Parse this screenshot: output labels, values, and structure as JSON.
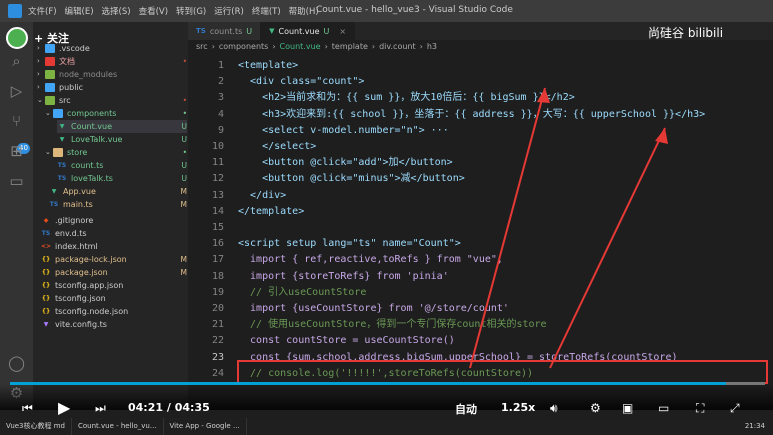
{
  "titlebar": {
    "menus": [
      "文件(F)",
      "编辑(E)",
      "选择(S)",
      "查看(V)",
      "转到(G)",
      "运行(R)",
      "终端(T)",
      "帮助(H)"
    ],
    "window_title": "Count.vue - hello_vue3 - Visual Studio Code"
  },
  "overlay": {
    "follow_label": "+ 关注",
    "brand": "尚硅谷 bilibili"
  },
  "sidebar": {
    "items": [
      {
        "name": ".vscode",
        "status": ""
      },
      {
        "name": "文档",
        "status": ""
      },
      {
        "name": "node_modules",
        "status": ""
      },
      {
        "name": "public",
        "status": ""
      },
      {
        "name": "src",
        "status": ""
      },
      {
        "name": "components",
        "status": ""
      },
      {
        "name": "Count.vue",
        "status": "U"
      },
      {
        "name": "LoveTalk.vue",
        "status": "U"
      },
      {
        "name": "store",
        "status": ""
      },
      {
        "name": "count.ts",
        "status": "U"
      },
      {
        "name": "loveTalk.ts",
        "status": "U"
      },
      {
        "name": "App.vue",
        "status": "M"
      },
      {
        "name": "main.ts",
        "status": "M"
      },
      {
        "name": ".gitignore",
        "status": ""
      },
      {
        "name": "env.d.ts",
        "status": ""
      },
      {
        "name": "index.html",
        "status": ""
      },
      {
        "name": "package-lock.json",
        "status": "M"
      },
      {
        "name": "package.json",
        "status": "M"
      },
      {
        "name": "tsconfig.app.json",
        "status": ""
      },
      {
        "name": "tsconfig.json",
        "status": ""
      },
      {
        "name": "tsconfig.node.json",
        "status": ""
      },
      {
        "name": "vite.config.ts",
        "status": ""
      }
    ]
  },
  "tabs": [
    {
      "label": "count.ts",
      "status": "U"
    },
    {
      "label": "Count.vue",
      "status": "U"
    }
  ],
  "breadcrumb": [
    "src",
    "components",
    "Count.vue",
    "template",
    "div.count",
    "h3"
  ],
  "editor": {
    "line_numbers": [
      "1",
      "2",
      "3",
      "4",
      "9",
      "10",
      "11",
      "12",
      "13",
      "14",
      "15",
      "16",
      "17",
      "18",
      "19",
      "20",
      "21",
      "22",
      "23",
      "24"
    ],
    "lines": [
      "<template>",
      "  <div class=\"count\">",
      "    <h2>当前求和为：{{ sum }}，放大10倍后：{{ bigSum }}</h2>",
      "    <h3>欢迎来到:{{ school }}，坐落于：{{ address }}，大写：{{ upperSchool }}</h3>",
      "    <select v-model.number=\"n\"> ···",
      "    </select>",
      "    <button @click=\"add\">加</button>",
      "    <button @click=\"minus\">减</button>",
      "  </div>",
      "</template>",
      "",
      "<script setup lang=\"ts\" name=\"Count\">",
      "  import { ref,reactive,toRefs } from \"vue\";",
      "  import {storeToRefs} from 'pinia'",
      "  // 引入useCountStore",
      "  import {useCountStore} from '@/store/count'",
      "  // 使用useCountStore，得到一个专门保存count相关的store",
      "  const countStore = useCountStore()",
      "  const {sum,school,address,bigSum,upperSchool} = storeToRefs(countStore)",
      "  // console.log('!!!!!',storeToRefs(countStore))"
    ]
  },
  "player": {
    "time_current": "04:21",
    "time_total": "04:35",
    "time_sep": "/",
    "quality": "自动",
    "speed": "1.25x",
    "progress": 0.948
  },
  "taskbar": {
    "items": [
      "Vue3核心教程 md",
      "Count.vue - hello_vu...",
      "Vite App - Google ..."
    ],
    "clock": "21:34"
  }
}
